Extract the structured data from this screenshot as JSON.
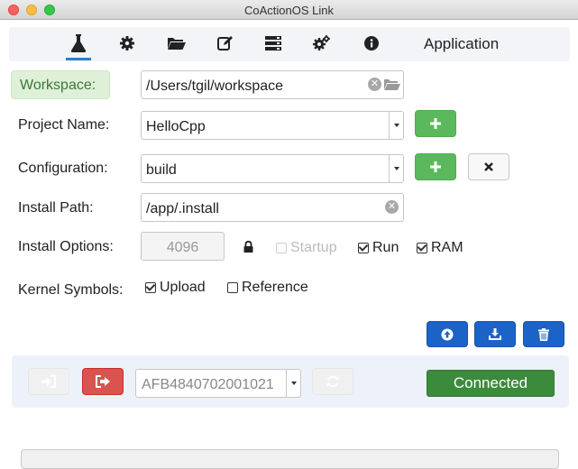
{
  "window": {
    "title": "CoActionOS Link"
  },
  "toolbar": {
    "icons": [
      "flask-icon",
      "gear-icon",
      "folder-open-icon",
      "edit-icon",
      "server-icon",
      "gears-icon",
      "info-icon"
    ],
    "active": "flask-icon",
    "section_label": "Application"
  },
  "workspace": {
    "label": "Workspace:",
    "value": "/Users/tgil/workspace"
  },
  "project": {
    "label": "Project Name:",
    "value": "HelloCpp"
  },
  "configuration": {
    "label": "Configuration:",
    "value": "build"
  },
  "install_path": {
    "label": "Install Path:",
    "value": "/app/.install"
  },
  "install_options": {
    "label": "Install Options:",
    "stack_size_placeholder": "4096",
    "startup": {
      "label": "Startup",
      "checked": false,
      "enabled": false
    },
    "run": {
      "label": "Run",
      "checked": true
    },
    "ram": {
      "label": "RAM",
      "checked": true
    }
  },
  "kernel_symbols": {
    "label": "Kernel Symbols:",
    "upload": {
      "label": "Upload",
      "checked": true
    },
    "reference": {
      "label": "Reference",
      "checked": false
    }
  },
  "connection": {
    "device_serial": "AFB4840702001021",
    "status": "Connected"
  },
  "colors": {
    "green": "#5cb85c",
    "blue": "#1c63c8",
    "red": "#d9534f",
    "connected": "#3c8a3c",
    "active_tab": "#2a7fd4"
  }
}
